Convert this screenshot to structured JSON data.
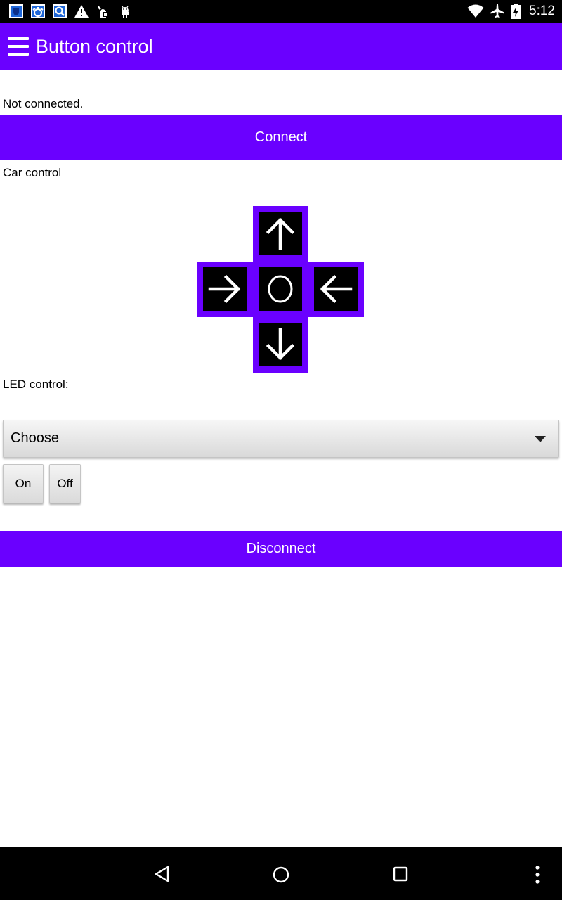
{
  "status_bar": {
    "time": "5:12",
    "left_icons": [
      "shield-app-icon",
      "settings-app-icon",
      "search-app-icon",
      "warning-icon",
      "usb-debug-icon",
      "android-icon"
    ],
    "right_icons": [
      "wifi-icon",
      "airplane-mode-icon",
      "battery-charging-icon"
    ]
  },
  "app_bar": {
    "title": "Button control",
    "menu_icon": "hamburger-menu-icon",
    "color": "#6a00ff"
  },
  "connection": {
    "status_text": "Not connected.",
    "connect_label": "Connect"
  },
  "car_control": {
    "label": "Car control",
    "buttons": [
      "up-arrow-icon",
      "right-arrow-icon",
      "stop-circle-icon",
      "left-arrow-icon",
      "down-arrow-icon"
    ]
  },
  "led_control": {
    "label": "LED control:",
    "spinner_value": "Choose",
    "on_label": "On",
    "off_label": "Off"
  },
  "disconnect_label": "Disconnect",
  "nav_bar": {
    "icons": [
      "back-icon",
      "home-icon",
      "recents-icon",
      "overflow-menu-icon"
    ]
  }
}
